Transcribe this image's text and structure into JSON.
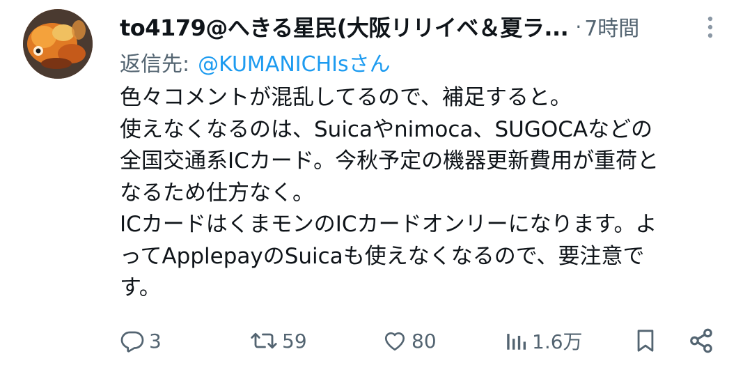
{
  "author": {
    "name": "to4179@へきる星民(大阪リリイベ＆夏ラ...",
    "time_sep": "·",
    "time": "7時間"
  },
  "reply": {
    "prefix": "返信先:",
    "handle": "@KUMANICHIsさん"
  },
  "body": {
    "lines": [
      "色々コメントが混乱してるので、補足すると。",
      "使えなくなるのは、Suicaやnimoca、SUGOCAなどの",
      "全国交通系ICカード。今秋予定の機器更新費用が重荷と",
      "なるため仕方なく。",
      "ICカードはくまモンのICカードオンリーになります。よ",
      "ってApplepayのSuicaも使えなくなるので、要注意で",
      "す。"
    ]
  },
  "actions": {
    "reply_count": "3",
    "retweet_count": "59",
    "like_count": "80",
    "view_count": "1.6万"
  },
  "colors": {
    "text": "#0f1419",
    "secondary": "#536471",
    "link": "#1d9bf0",
    "background": "#ffffff"
  },
  "icons": {
    "more": "more-vertical-icon",
    "reply": "reply-bubble-icon",
    "retweet": "retweet-icon",
    "like": "heart-icon",
    "views": "bar-chart-icon",
    "bookmark": "bookmark-icon",
    "share": "share-icon"
  }
}
